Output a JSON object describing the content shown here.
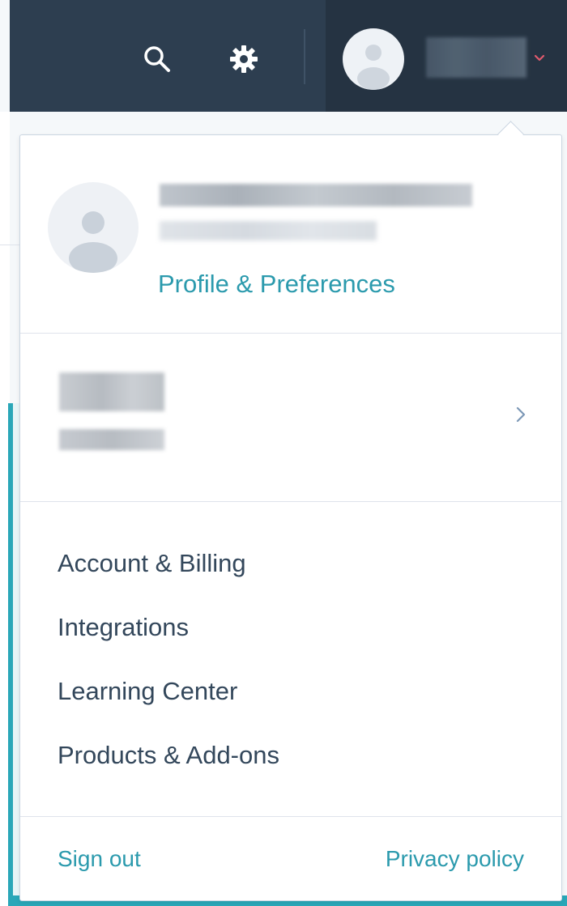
{
  "colors": {
    "navbar": "#2d3e50",
    "navbar_account": "#253342",
    "accent_link": "#2b9aad",
    "menu_text": "#33475b",
    "caret": "#e05a6d",
    "teal_background": "#2aa7b8"
  },
  "navbar": {
    "icons": [
      "search-icon",
      "gear-icon",
      "avatar-icon",
      "chevron-down-icon"
    ]
  },
  "dropdown": {
    "profile": {
      "link_label": "Profile & Preferences"
    },
    "account": {
      "icon": "chevron-right-icon"
    },
    "menu_items": [
      {
        "label": "Account & Billing"
      },
      {
        "label": "Integrations"
      },
      {
        "label": "Learning Center"
      },
      {
        "label": "Products & Add-ons"
      }
    ],
    "footer": {
      "sign_out_label": "Sign out",
      "privacy_label": "Privacy policy"
    }
  }
}
